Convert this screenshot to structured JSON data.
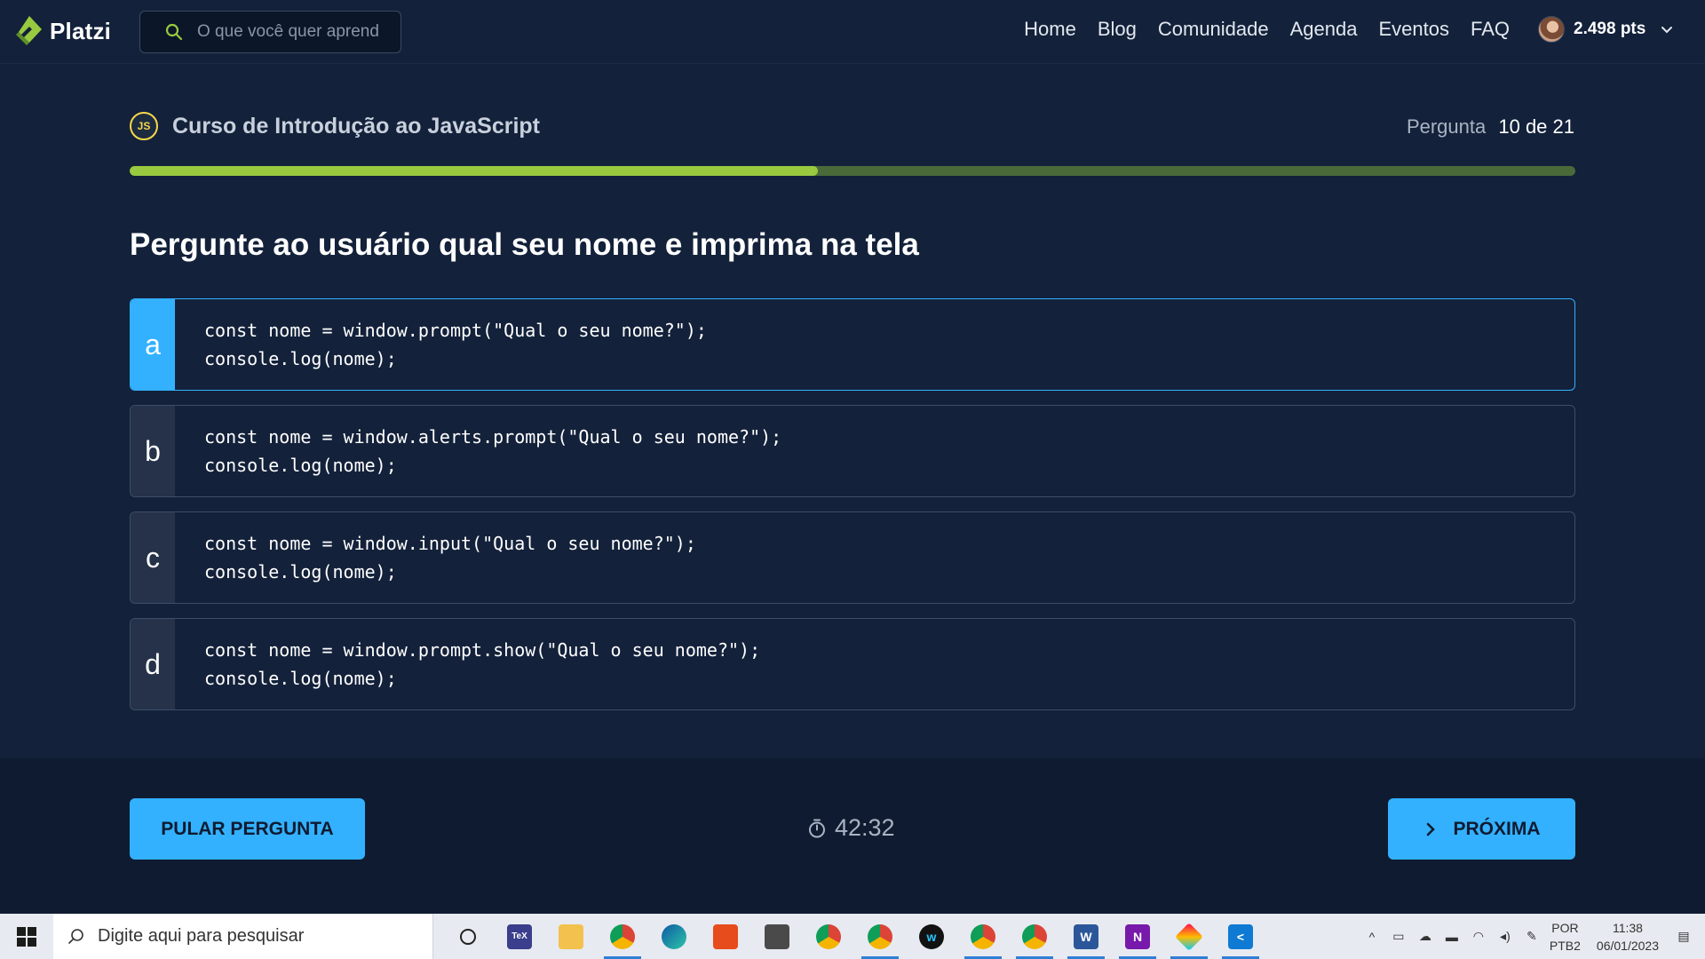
{
  "nav": {
    "logo": "Platzi",
    "search_placeholder": "O que você quer aprend",
    "links": [
      "Home",
      "Blog",
      "Comunidade",
      "Agenda",
      "Eventos",
      "FAQ"
    ],
    "points": "2.498 pts"
  },
  "course": {
    "badge": "JS",
    "title": "Curso de Introdução ao JavaScript",
    "question_label": "Pergunta",
    "question_number": "10 de 21",
    "progress": 0.476
  },
  "question": "Pergunte ao usuário qual seu nome e imprima na tela",
  "options": [
    {
      "letter": "a",
      "line1": "const nome = window.prompt(\"Qual o seu nome?\");",
      "line2": "console.log(nome);",
      "selected": true
    },
    {
      "letter": "b",
      "line1": "const nome = window.alerts.prompt(\"Qual o seu nome?\");",
      "line2": "console.log(nome);",
      "selected": false
    },
    {
      "letter": "c",
      "line1": "const nome = window.input(\"Qual o seu nome?\");",
      "line2": "console.log(nome);",
      "selected": false
    },
    {
      "letter": "d",
      "line1": "const nome = window.prompt.show(\"Qual o seu nome?\");",
      "line2": "console.log(nome);",
      "selected": false
    }
  ],
  "footer": {
    "skip_label": "PULAR PERGUNTA",
    "timer": "42:32",
    "next_label": "PRÓXIMA"
  },
  "taskbar": {
    "search_text": "Digite aqui para pesquisar",
    "lang_top": "POR",
    "lang_bottom": "PTB2",
    "time": "11:38",
    "date": "06/01/2023"
  },
  "colors": {
    "background": "#13213a",
    "accent": "#33b1ff",
    "progress": "#98ca3f",
    "progress_track": "#4a6a39",
    "js_badge": "#f6d84a"
  }
}
